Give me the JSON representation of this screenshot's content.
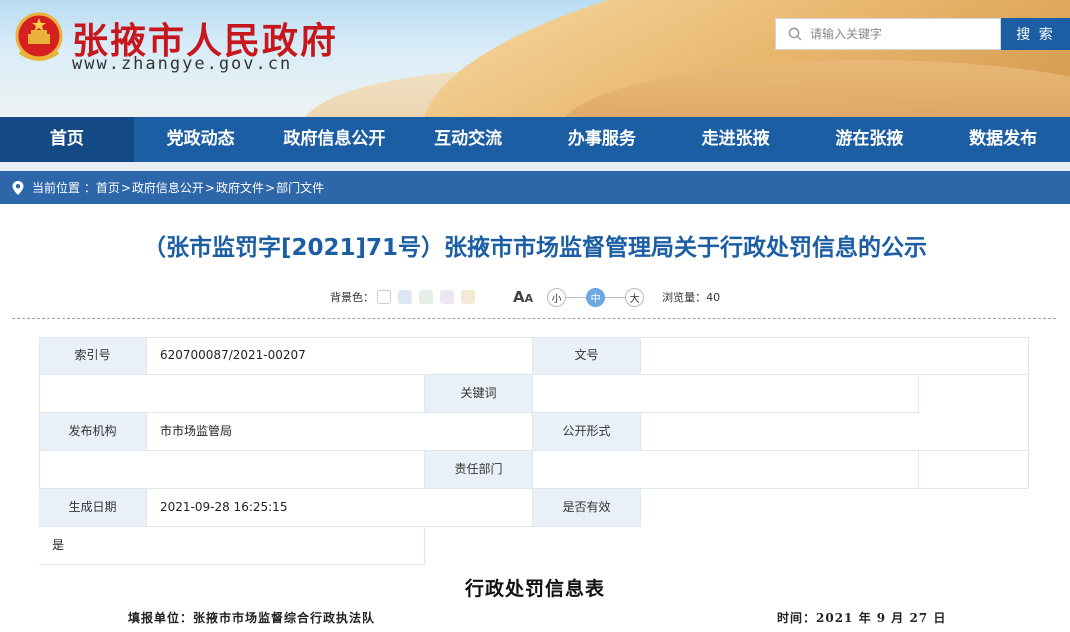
{
  "header": {
    "site_title": "张掖市人民政府",
    "site_url": "www.zhangye.gov.cn",
    "emblem_icon": "national-emblem-icon",
    "search": {
      "placeholder": "请输入关键字",
      "value": "",
      "button_label": "搜 索"
    }
  },
  "nav": {
    "items": [
      {
        "label": "首页",
        "active": true
      },
      {
        "label": "党政动态"
      },
      {
        "label": "政府信息公开"
      },
      {
        "label": "互动交流"
      },
      {
        "label": "办事服务"
      },
      {
        "label": "走进张掖"
      },
      {
        "label": "游在张掖"
      },
      {
        "label": "数据发布"
      }
    ]
  },
  "breadcrumb": {
    "prefix": "当前位置 ：",
    "items": [
      "首页",
      "政府信息公开",
      "政府文件",
      "部门文件"
    ],
    "separator": ">"
  },
  "article": {
    "title": "（张市监罚字[2021]71号）张掖市市场监督管理局关于行政处罚信息的公示"
  },
  "tools": {
    "bg_label": "背景色：",
    "bg_colors": [
      "#ffffff",
      "#dde7f3",
      "#e3efe7",
      "#ece6f1",
      "#f3ead5"
    ],
    "font_label": "A",
    "font_small": "A",
    "sizes": [
      "小",
      "中",
      "大"
    ],
    "active_size": "中",
    "views_label": "浏览量：",
    "views_value": "40"
  },
  "info": {
    "index_label": "索引号",
    "index_value": "620700087/2021-00207",
    "docno_label": "文号",
    "docno_value": "",
    "keywords_label": "关键词",
    "keywords_value": "",
    "publisher_label": "发布机构",
    "publisher_value": "市市场监管局",
    "public_form_label": "公开形式",
    "public_form_value": "",
    "dept_label": "责任部门",
    "dept_value": "",
    "date_label": "生成日期",
    "date_value": "2021-09-28 16:25:15",
    "valid_label": "是否有效",
    "valid_value": "是"
  },
  "document": {
    "title": "行政处罚信息表",
    "unit": "填报单位：张掖市市场监督综合行政执法队",
    "date": "时间：2021 年 9 月 27 日"
  },
  "colors": {
    "primary": "#1c5ea3",
    "brand_red": "#c8161d",
    "label_bg": "#e9f0f7"
  }
}
